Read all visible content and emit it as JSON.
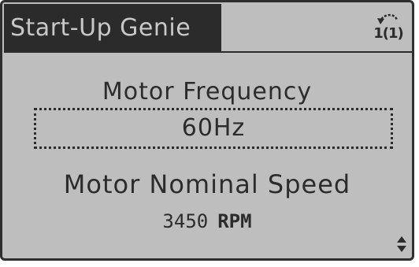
{
  "header": {
    "title": "Start-Up Genie",
    "indicator_text": "1(1)",
    "indicator_icon": "back-arrow-icon"
  },
  "parameter_1": {
    "label": "Motor Frequency",
    "value": "60Hz"
  },
  "parameter_2": {
    "label": "Motor Nominal Speed",
    "value": "3450",
    "unit": "RPM"
  },
  "scroll": {
    "icon": "up-down-scroll-icon"
  },
  "colors": {
    "lcd_background": "#bebebe",
    "lcd_foreground": "#2b2b2b"
  }
}
